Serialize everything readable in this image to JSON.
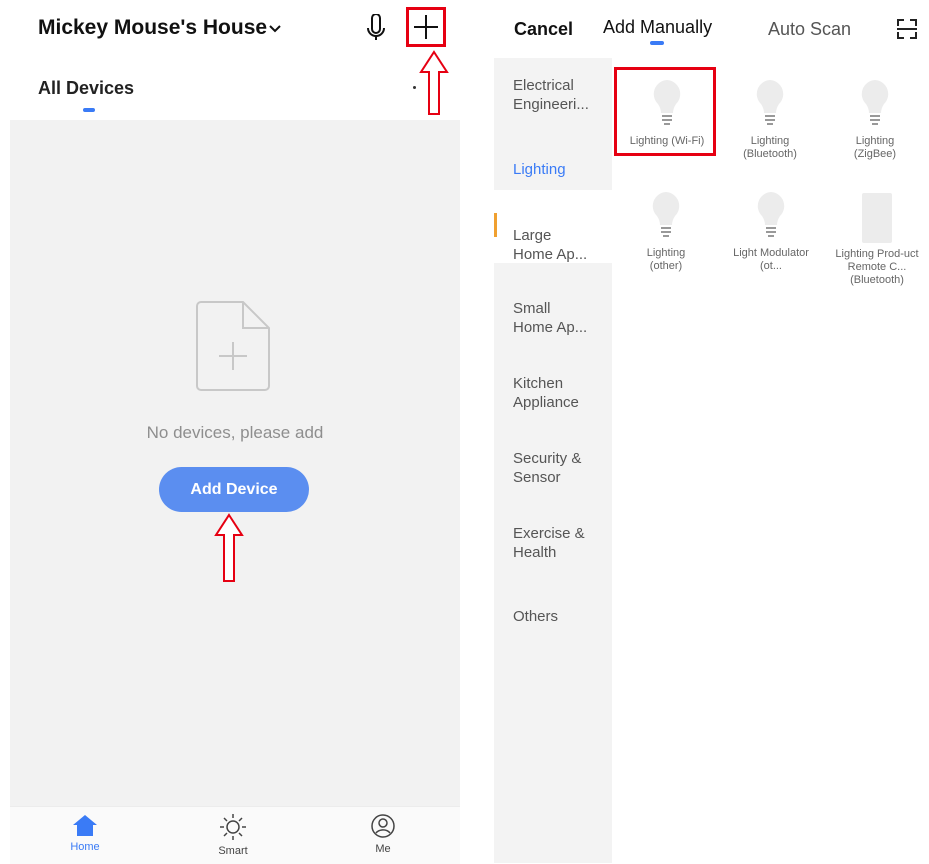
{
  "left": {
    "home_title": "Mickey Mouse's House",
    "all_devices_label": "All Devices",
    "empty_message": "No devices, please add",
    "add_device_label": "Add Device",
    "tabs": [
      {
        "label": "Home",
        "icon": "home-icon",
        "active": true
      },
      {
        "label": "Smart",
        "icon": "sun-icon",
        "active": false
      },
      {
        "label": "Me",
        "icon": "user-icon",
        "active": false
      }
    ]
  },
  "right": {
    "cancel_label": "Cancel",
    "tabs": [
      {
        "label": "Add Manually",
        "active": true
      },
      {
        "label": "Auto Scan",
        "active": false
      }
    ],
    "categories": [
      {
        "label": "Electrical Engineeri..."
      },
      {
        "label": "Lighting",
        "active": true
      },
      {
        "label": "Large Home Ap..."
      },
      {
        "label": "Small Home Ap..."
      },
      {
        "label": "Kitchen Appliance"
      },
      {
        "label": "Security & Sensor"
      },
      {
        "label": "Exercise & Health"
      },
      {
        "label": "Others"
      }
    ],
    "products": [
      {
        "label": "Lighting (Wi-Fi)",
        "icon": "bulb-icon"
      },
      {
        "label": "Lighting (Bluetooth)",
        "icon": "bulb-icon"
      },
      {
        "label": "Lighting (ZigBee)",
        "icon": "bulb-icon"
      },
      {
        "label": "Lighting (other)",
        "icon": "bulb-icon"
      },
      {
        "label": "Light Modulator (ot...",
        "icon": "bulb-icon"
      },
      {
        "label": "Lighting Prod-uct Remote C... (Bluetooth)",
        "icon": "remote-icon"
      }
    ]
  },
  "colors": {
    "accent": "#3a7bf6",
    "button": "#5b8ef0",
    "highlight_red": "#e60012",
    "category_indicator": "#f0a030"
  }
}
